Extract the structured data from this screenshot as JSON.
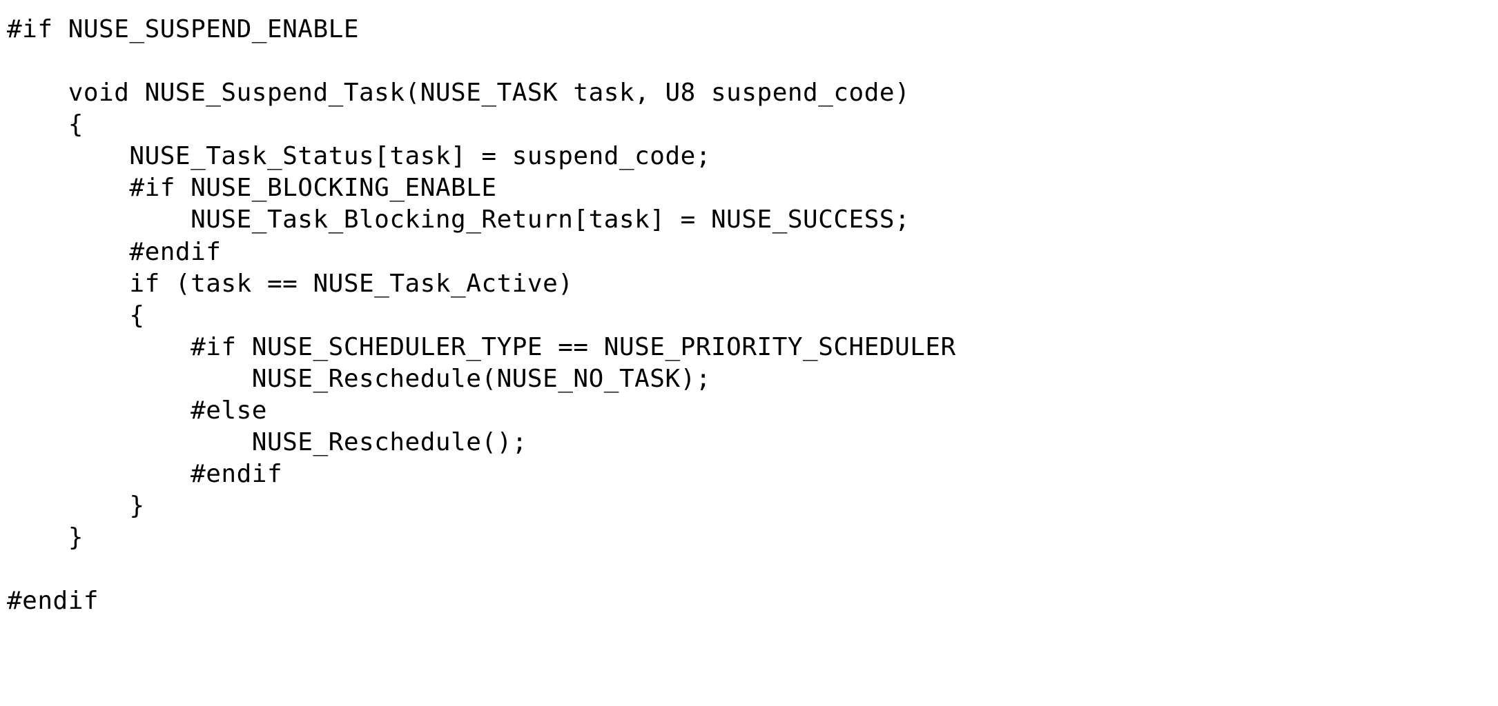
{
  "code": {
    "lines": [
      "#if NUSE_SUSPEND_ENABLE",
      "",
      "    void NUSE_Suspend_Task(NUSE_TASK task, U8 suspend_code)",
      "    {",
      "        NUSE_Task_Status[task] = suspend_code;",
      "        #if NUSE_BLOCKING_ENABLE",
      "            NUSE_Task_Blocking_Return[task] = NUSE_SUCCESS;",
      "        #endif",
      "        if (task == NUSE_Task_Active)",
      "        {",
      "            #if NUSE_SCHEDULER_TYPE == NUSE_PRIORITY_SCHEDULER",
      "                NUSE_Reschedule(NUSE_NO_TASK);",
      "            #else",
      "                NUSE_Reschedule();",
      "            #endif",
      "        }",
      "    }",
      "",
      "#endif"
    ]
  }
}
